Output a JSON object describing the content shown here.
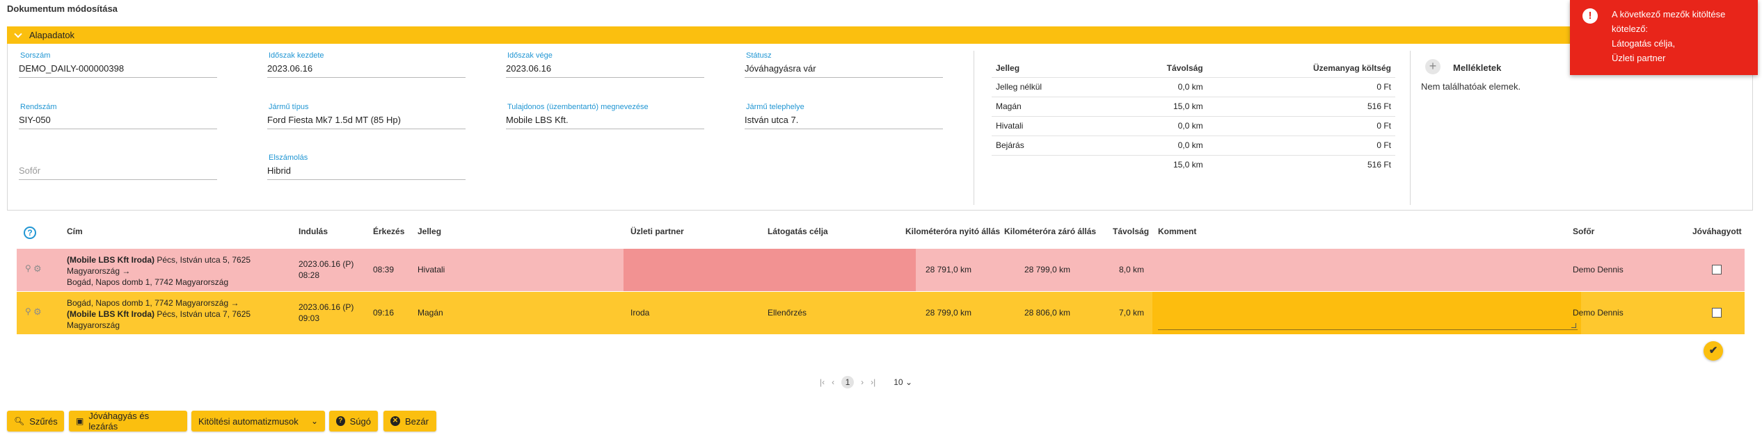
{
  "page": {
    "title": "Dokumentum módosítása"
  },
  "panel": {
    "title": "Alapadatok",
    "fields": {
      "sorszam": {
        "label": "Sorszám",
        "value": "DEMO_DAILY-000000398"
      },
      "idoszak_kezdete": {
        "label": "Időszak kezdete",
        "value": "2023.06.16"
      },
      "idoszak_vege": {
        "label": "Időszak vége",
        "value": "2023.06.16"
      },
      "statusz": {
        "label": "Státusz",
        "value": "Jóváhagyásra vár"
      },
      "rendszam": {
        "label": "Rendszám",
        "value": "SIY-050"
      },
      "jarmu_tipus": {
        "label": "Jármű típus",
        "value": "Ford Fiesta Mk7 1.5d MT (85 Hp)"
      },
      "tulajdonos": {
        "label": "Tulajdonos (üzembentartó) megnevezése",
        "value": "Mobile LBS Kft."
      },
      "telephely": {
        "label": "Jármű telephelye",
        "value": "István utca 7."
      },
      "sofor": {
        "placeholder": "Sofőr"
      },
      "elszamolas": {
        "label": "Elszámolás",
        "value": "Hibrid"
      }
    }
  },
  "jelleg_summary": {
    "headers": [
      "Jelleg",
      "Távolság",
      "Üzemanyag költség"
    ],
    "rows": [
      {
        "jelleg": "Jelleg nélkül",
        "tavolsag": "0,0 km",
        "koltseg": "0 Ft"
      },
      {
        "jelleg": "Magán",
        "tavolsag": "15,0 km",
        "koltseg": "516 Ft"
      },
      {
        "jelleg": "Hivatali",
        "tavolsag": "0,0 km",
        "koltseg": "0 Ft"
      },
      {
        "jelleg": "Bejárás",
        "tavolsag": "0,0 km",
        "koltseg": "0 Ft"
      }
    ],
    "total": {
      "jelleg": "",
      "tavolsag": "15,0 km",
      "koltseg": "516 Ft"
    }
  },
  "attachments": {
    "title": "Mellékletek",
    "empty_text": "Nem találhatóak elemek."
  },
  "grid": {
    "headers": {
      "cim": "Cím",
      "indulas": "Indulás",
      "erkezes": "Érkezés",
      "jelleg": "Jelleg",
      "partner": "Üzleti partner",
      "cel": "Látogatás célja",
      "km_nyito": "Kilométeróra nyitó állás",
      "km_zaro": "Kilométeróra záró állás",
      "tavolsag": "Távolság",
      "komment": "Komment",
      "sofor": "Sofőr",
      "jovahagyott": "Jóváhagyott"
    },
    "rows": [
      {
        "cim_line1_bold": "(Mobile LBS Kft Iroda)",
        "cim_line1_rest": " Pécs, István utca 5, 7625",
        "cim_line2": "Magyarország →",
        "cim_line3": "Bogád, Napos domb 1, 7742 Magyarország",
        "indulas_date": "2023.06.16 (P)",
        "indulas_time": "08:28",
        "erkezes": "08:39",
        "jelleg": "Hivatali",
        "partner": "",
        "cel": "",
        "km_nyito": "28 791,0 km",
        "km_zaro": "28 799,0 km",
        "tavolsag": "8,0 km",
        "komment": "",
        "sofor": "Demo Dennis"
      },
      {
        "cim_line1": "Bogád, Napos domb 1, 7742 Magyarország →",
        "cim_line2_bold": "(Mobile LBS Kft Iroda)",
        "cim_line2_rest": " Pécs, István utca 7, 7625",
        "cim_line3": "Magyarország",
        "indulas_date": "2023.06.16 (P)",
        "indulas_time": "09:03",
        "erkezes": "09:16",
        "jelleg": "Magán",
        "partner": "Iroda",
        "cel": "Ellenőrzés",
        "km_nyito": "28 799,0 km",
        "km_zaro": "28 806,0 km",
        "tavolsag": "7,0 km",
        "komment": "",
        "sofor": "Demo Dennis"
      }
    ]
  },
  "pagination": {
    "current_page": "1",
    "page_size": "10"
  },
  "toolbar": {
    "szures": "Szűrés",
    "jovahagyas": "Jóváhagyás és lezárás",
    "automatizmusok": "Kitöltési automatizmusok",
    "sugo": "Súgó",
    "bezar": "Bezár"
  },
  "toast": {
    "line1": "A következő mezők kitöltése",
    "line2": "kötelező:",
    "line3": "Látogatás célja,",
    "line4": "Üzleti partner"
  },
  "colors": {
    "accent": "#fbbf0f",
    "error_row": "#f8b9b9",
    "error_cell": "#f29292",
    "link_label": "#2196d3",
    "toast": "#e8251a"
  }
}
